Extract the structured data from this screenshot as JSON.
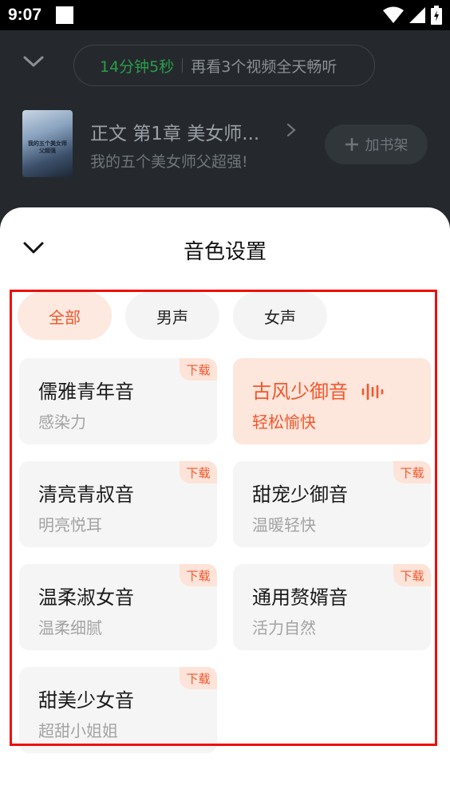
{
  "status_bar": {
    "time": "9:07"
  },
  "player": {
    "timer_label": "14分钟5秒",
    "timer_hint": "再看3个视频全天畅听",
    "book_cover_text": "我的五个美女师父超强",
    "chapter_title": "正文 第1章 美女师...",
    "book_title": "我的五个美女师父超强!",
    "shelf_button": "加书架"
  },
  "sheet": {
    "title": "音色设置",
    "filters": [
      {
        "label": "全部",
        "active": true
      },
      {
        "label": "男声",
        "active": false
      },
      {
        "label": "女声",
        "active": false
      }
    ],
    "voices": [
      {
        "name": "儒雅青年音",
        "desc": "感染力",
        "badge": "下载",
        "selected": false
      },
      {
        "name": "古风少御音",
        "desc": "轻松愉快",
        "badge": "",
        "selected": true
      },
      {
        "name": "清亮青叔音",
        "desc": "明亮悦耳",
        "badge": "下载",
        "selected": false
      },
      {
        "name": "甜宠少御音",
        "desc": "温暖轻快",
        "badge": "下载",
        "selected": false
      },
      {
        "name": "温柔淑女音",
        "desc": "温柔细腻",
        "badge": "下载",
        "selected": false
      },
      {
        "name": "通用赘婿音",
        "desc": "活力自然",
        "badge": "下载",
        "selected": false
      },
      {
        "name": "甜美少女音",
        "desc": "超甜小姐姐",
        "badge": "下载",
        "selected": false
      }
    ]
  },
  "colors": {
    "accent": "#f2572d",
    "timer_green": "#2a9d4b",
    "highlight": "#ef0e0e"
  }
}
